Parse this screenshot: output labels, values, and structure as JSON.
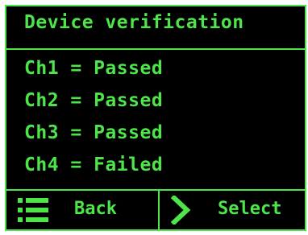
{
  "colors": {
    "accent": "#4ee54a",
    "background": "#000000"
  },
  "header": {
    "title": "Device verification"
  },
  "status": {
    "rows": [
      {
        "text": "Ch1 = Passed"
      },
      {
        "text": "Ch2 = Passed"
      },
      {
        "text": "Ch3 = Passed"
      },
      {
        "text": "Ch4 = Failed"
      }
    ]
  },
  "footer": {
    "back": {
      "label": "Back",
      "icon": "menu-list-icon"
    },
    "select": {
      "label": "Select",
      "icon": "chevron-right-icon"
    }
  }
}
